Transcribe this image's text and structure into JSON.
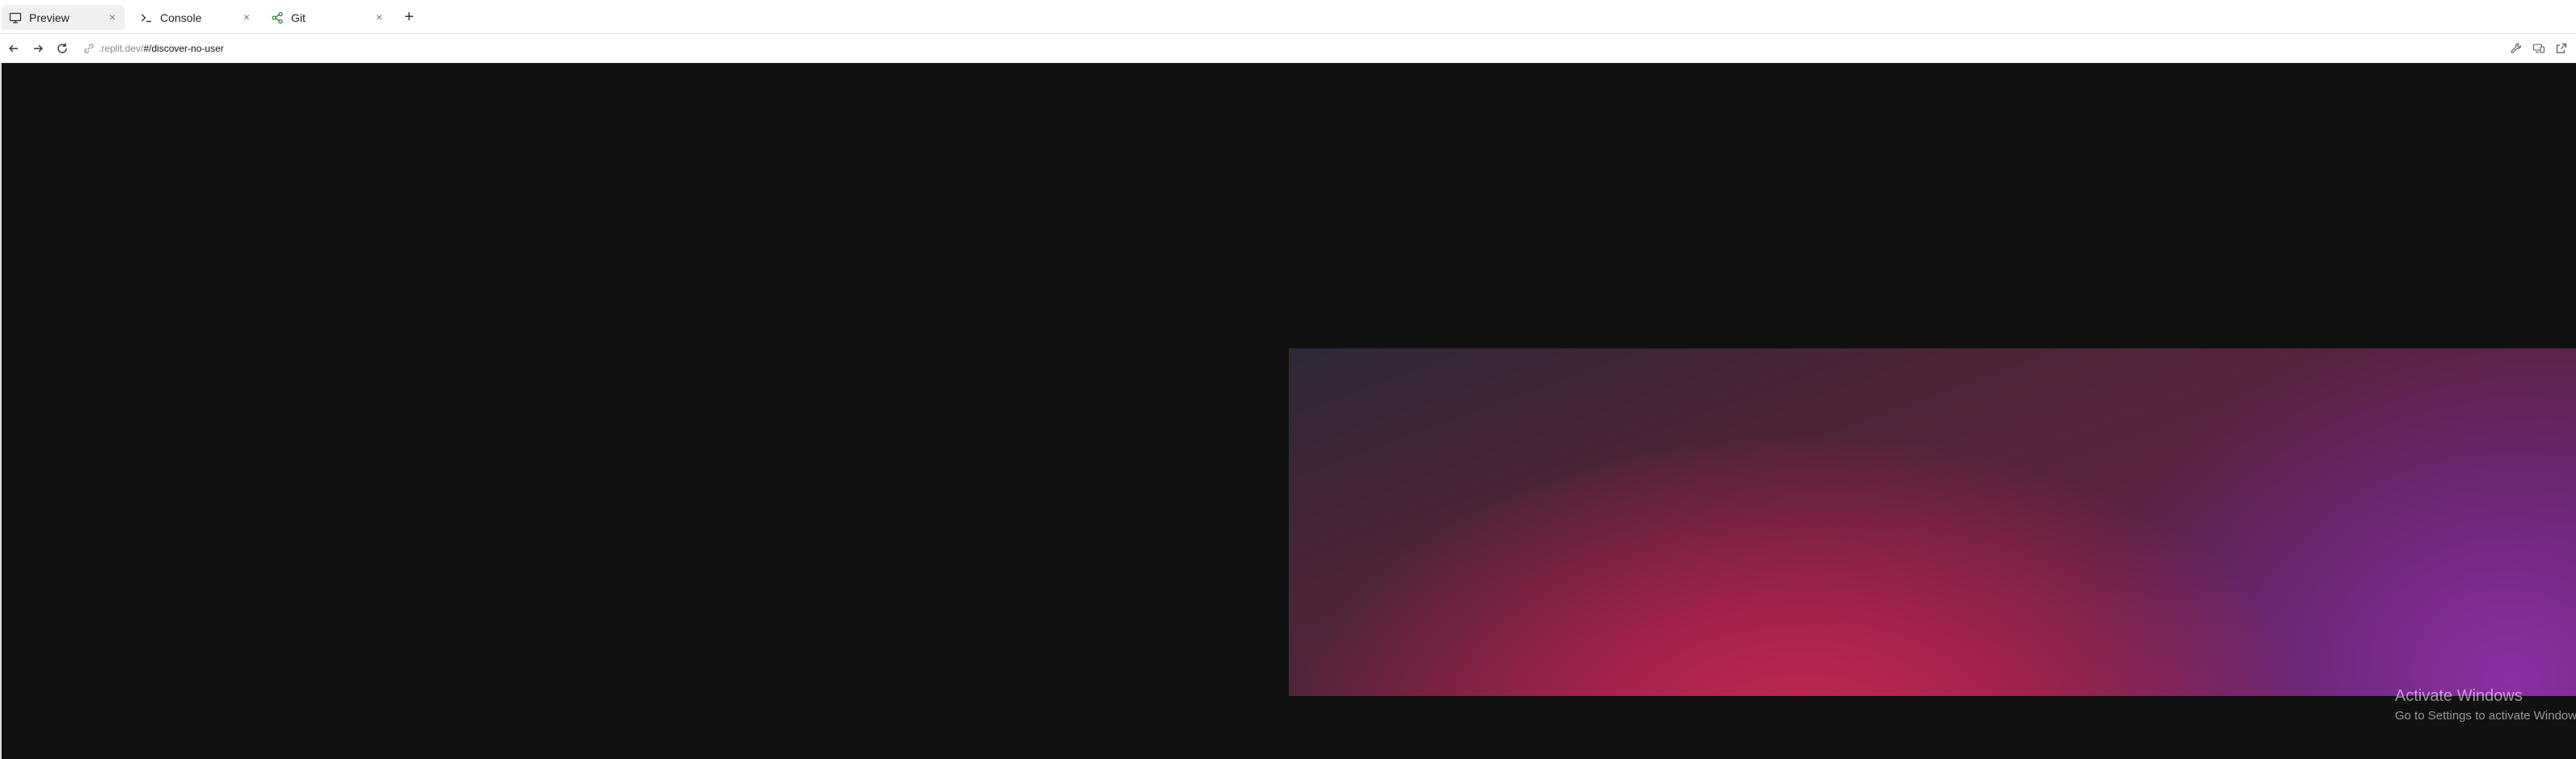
{
  "tabs": [
    {
      "label": "Preview",
      "icon": "monitor-icon",
      "active": true
    },
    {
      "label": "Console",
      "icon": "terminal-icon",
      "active": false
    },
    {
      "label": "Git",
      "icon": "git-branch-icon",
      "active": false
    }
  ],
  "new_tab_label": "+",
  "close_glyph": "×",
  "address": {
    "host": ".replit.dev/",
    "path": "#/discover-no-user"
  },
  "watermark": {
    "title": "Activate Windows",
    "subtitle": "Go to Settings to activate Windows."
  }
}
